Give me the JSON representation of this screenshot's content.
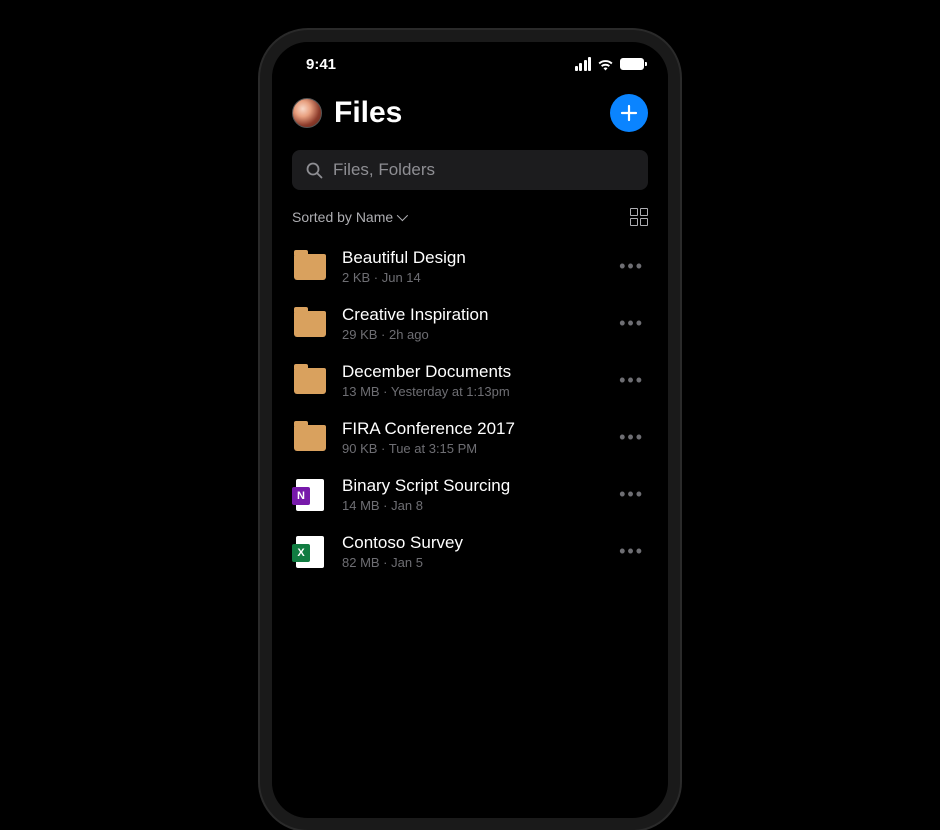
{
  "statusBar": {
    "time": "9:41"
  },
  "header": {
    "title": "Files"
  },
  "search": {
    "placeholder": "Files, Folders"
  },
  "sort": {
    "label": "Sorted by Name"
  },
  "items": [
    {
      "icon": "folder",
      "name": "Beautiful Design",
      "meta": "2 KB · Jun 14"
    },
    {
      "icon": "folder",
      "name": "Creative Inspiration",
      "meta": "29 KB · 2h ago"
    },
    {
      "icon": "folder",
      "name": "December Documents",
      "meta": "13 MB · Yesterday at 1:13pm"
    },
    {
      "icon": "folder",
      "name": "FIRA Conference 2017",
      "meta": "90 KB · Tue at 3:15 PM"
    },
    {
      "icon": "onenote",
      "badge": "N",
      "name": "Binary Script Sourcing",
      "meta": "14 MB · Jan 8"
    },
    {
      "icon": "excel",
      "badge": "X",
      "name": "Contoso Survey",
      "meta": "82 MB · Jan 5"
    }
  ],
  "colors": {
    "accent": "#0a84ff",
    "folder": "#d9a15e",
    "onenote": "#7719aa",
    "excel": "#107c41"
  }
}
